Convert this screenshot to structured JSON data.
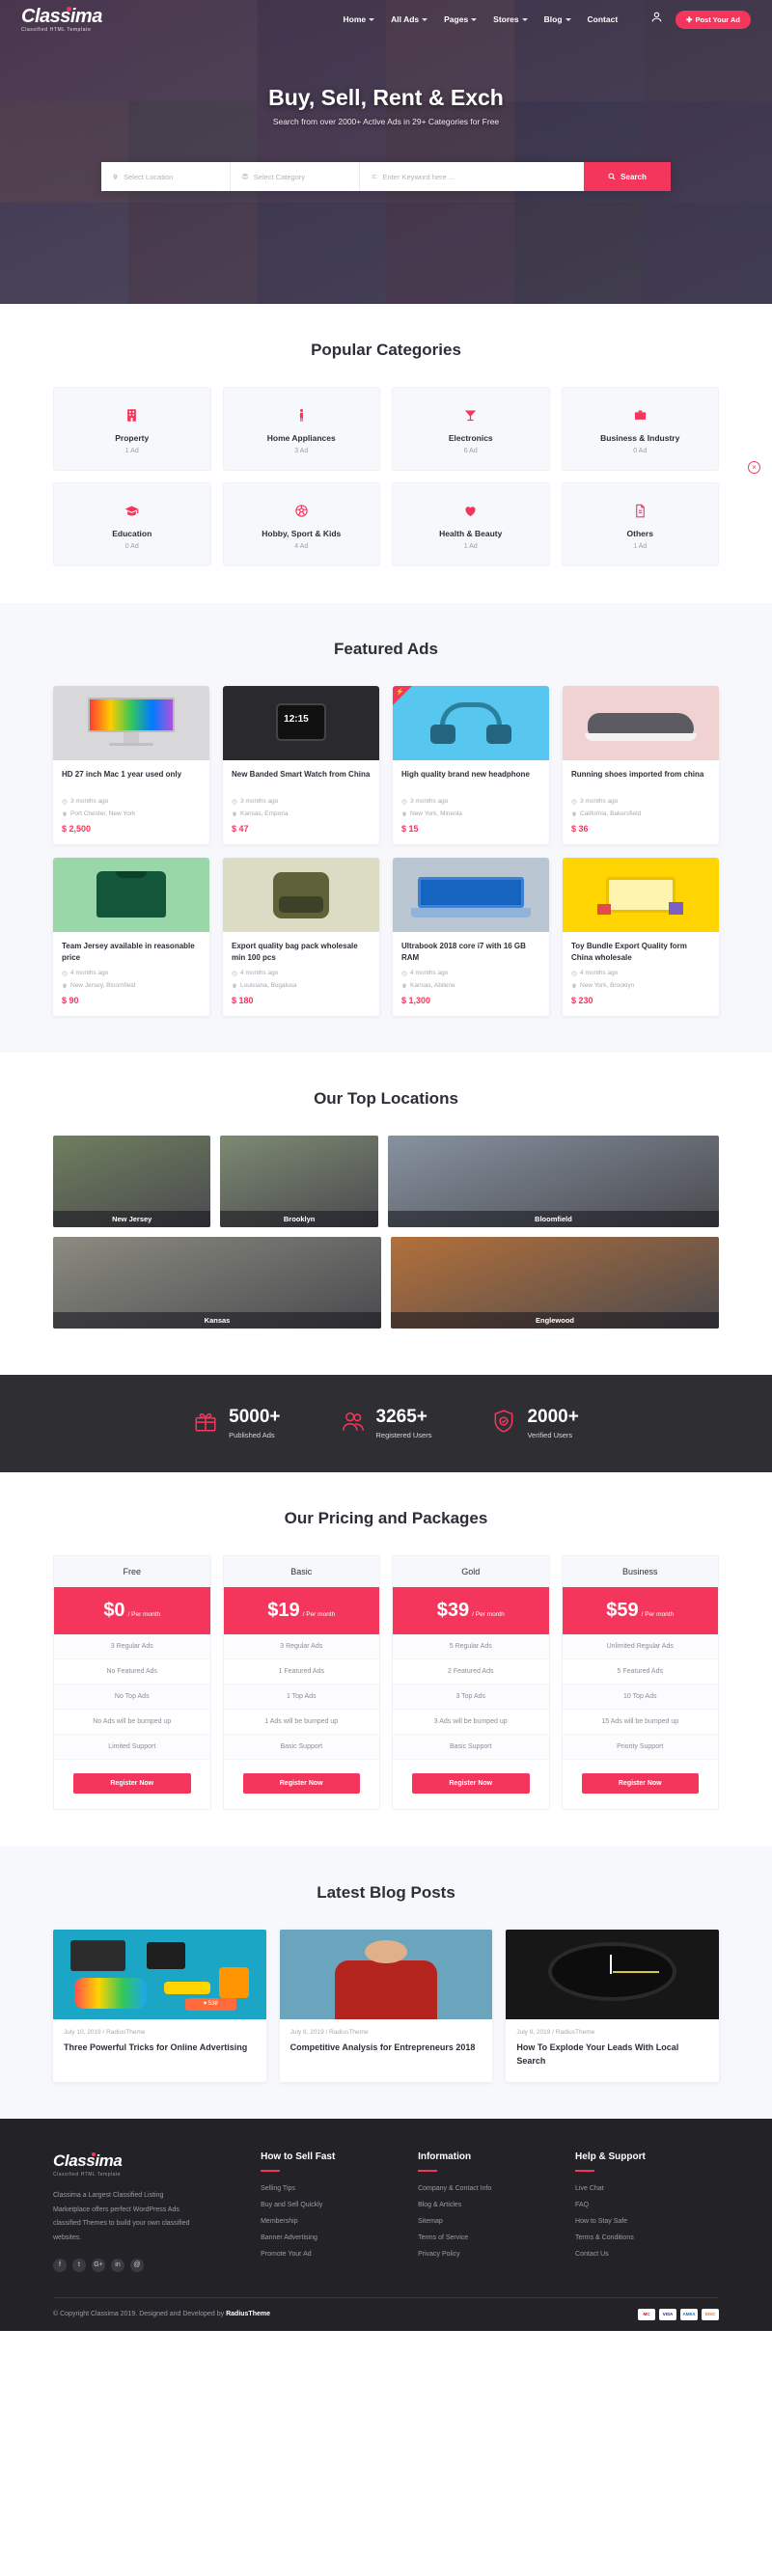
{
  "brand": {
    "name": "Classima",
    "tagline": "Classified HTML Template",
    "accent": "#f5365c"
  },
  "nav": {
    "items": [
      {
        "label": "Home",
        "caret": true
      },
      {
        "label": "All Ads",
        "caret": true
      },
      {
        "label": "Pages",
        "caret": true
      },
      {
        "label": "Stores",
        "caret": true
      },
      {
        "label": "Blog",
        "caret": true
      },
      {
        "label": "Contact",
        "caret": false
      }
    ],
    "post_ad_label": "Post Your Ad"
  },
  "hero": {
    "title": "Buy, Sell, Rent & Exch",
    "subtitle": "Search from over 2000+ Active Ads in 29+ Categories for Free",
    "search": {
      "location_placeholder": "Select Location",
      "category_placeholder": "Select Category",
      "keyword_placeholder": "Enter Keyword here ...",
      "button_label": "Search"
    }
  },
  "categories": {
    "title": "Popular Categories",
    "items": [
      {
        "name": "Property",
        "count": "1 Ad",
        "icon": "building-icon"
      },
      {
        "name": "Home Appliances",
        "count": "3 Ad",
        "icon": "person-icon"
      },
      {
        "name": "Electronics",
        "count": "6 Ad",
        "icon": "cocktail-icon"
      },
      {
        "name": "Business & Industry",
        "count": "0 Ad",
        "icon": "briefcase-icon"
      },
      {
        "name": "Education",
        "count": "0 Ad",
        "icon": "graduation-cap-icon"
      },
      {
        "name": "Hobby, Sport & Kids",
        "count": "4 Ad",
        "icon": "soccer-ball-icon"
      },
      {
        "name": "Health & Beauty",
        "count": "1 Ad",
        "icon": "heart-icon"
      },
      {
        "name": "Others",
        "count": "1 Ad",
        "icon": "document-icon"
      }
    ]
  },
  "featured": {
    "title": "Featured Ads",
    "items": [
      {
        "title": "HD 27 inch Mac 1 year used only",
        "time": "3 months ago",
        "location": "Port Chester, New York",
        "price": "$ 2,500",
        "featured": false,
        "bg": "#d8d8da"
      },
      {
        "title": "New Banded Smart Watch from China",
        "time": "3 months ago",
        "location": "Kansas, Emporia",
        "price": "$ 47",
        "featured": false,
        "bg": "#2a2a2e"
      },
      {
        "title": "High quality brand new headphone",
        "time": "3 months ago",
        "location": "New York, Mineola",
        "price": "$ 15",
        "featured": true,
        "bg": "#58c7f0"
      },
      {
        "title": "Running shoes imported from china",
        "time": "3 months ago",
        "location": "California, Bakersfield",
        "price": "$ 36",
        "featured": false,
        "bg": "#f0d2d2"
      },
      {
        "title": "Team Jersey available in reasonable price",
        "time": "4 months ago",
        "location": "New Jersey, Bloomfield",
        "price": "$ 90",
        "featured": false,
        "bg": "#9ad7a8"
      },
      {
        "title": "Export quality bag pack wholesale min 100 pcs",
        "time": "4 months ago",
        "location": "Louisiana, Bogalusa",
        "price": "$ 180",
        "featured": false,
        "bg": "#dcdcc4"
      },
      {
        "title": "Ultrabook 2018 core i7 with 16 GB RAM",
        "time": "4 months ago",
        "location": "Kansas, Abilene",
        "price": "$ 1,300",
        "featured": false,
        "bg": "#b9c6d2"
      },
      {
        "title": "Toy Bundle Export Quality form China wholesale",
        "time": "4 months ago",
        "location": "New York, Brooklyn",
        "price": "$ 230",
        "featured": false,
        "bg": "#ffd400"
      }
    ]
  },
  "locations": {
    "title": "Our Top Locations",
    "items": [
      {
        "name": "New Jersey",
        "bg": "#6f7f5e"
      },
      {
        "name": "Brooklyn",
        "bg": "#7d8a72"
      },
      {
        "name": "Bloomfield",
        "bg": "#8792a0"
      },
      {
        "name": "Kansas",
        "bg": "#8b8b80"
      },
      {
        "name": "Englewood",
        "bg": "#b4703a"
      }
    ]
  },
  "counters": [
    {
      "number": "5000+",
      "label": "Published Ads",
      "icon": "gift-icon"
    },
    {
      "number": "3265+",
      "label": "Registered Users",
      "icon": "users-icon"
    },
    {
      "number": "2000+",
      "label": "Verified Users",
      "icon": "shield-check-icon"
    }
  ],
  "pricing": {
    "title": "Our Pricing and Packages",
    "per_month": "/ Per month",
    "register_label": "Register Now",
    "plans": [
      {
        "name": "Free",
        "price": "$0",
        "features": [
          "3 Regular Ads",
          "No Featured Ads",
          "No Top Ads",
          "No Ads will be bumped up",
          "Limited Support"
        ]
      },
      {
        "name": "Basic",
        "price": "$19",
        "features": [
          "3 Regular Ads",
          "1 Featured Ads",
          "1 Top Ads",
          "1 Ads will be bumped up",
          "Basic Support"
        ]
      },
      {
        "name": "Gold",
        "price": "$39",
        "features": [
          "5 Regular Ads",
          "2 Featured Ads",
          "3 Top Ads",
          "3 Ads will be bumped up",
          "Basic Support"
        ]
      },
      {
        "name": "Business",
        "price": "$59",
        "features": [
          "Unlimited Regular Ads",
          "5 Featured Ads",
          "10 Top Ads",
          "15 Ads will be bumped up",
          "Priority Support"
        ]
      }
    ]
  },
  "blog": {
    "title": "Latest Blog Posts",
    "posts": [
      {
        "meta": "July 10, 2019 / RadiusTheme",
        "title": "Three Powerful Tricks for Online Advertising",
        "bg": "#1aa6c4"
      },
      {
        "meta": "July 8, 2019 / RadiusTheme",
        "title": "Competitive Analysis for Entrepreneurs 2018",
        "bg": "#6aa5bd"
      },
      {
        "meta": "July 8, 2019 / RadiusTheme",
        "title": "How To Explode Your Leads With Local Search",
        "bg": "#171717"
      }
    ]
  },
  "footer": {
    "description": "Classima a Largest Classified Listing Marketplace offers perfect WordPress Ads classified Themes to build your own classified websites.",
    "socials": [
      "f",
      "t",
      "G+",
      "in",
      "@"
    ],
    "columns": [
      {
        "heading": "How to Sell Fast",
        "links": [
          "Selling Tips",
          "Buy and Sell Quickly",
          "Membership",
          "Banner Advertising",
          "Promote Your Ad"
        ]
      },
      {
        "heading": "Information",
        "links": [
          "Company & Contact Info",
          "Blog & Articles",
          "Sitemap",
          "Terms of Service",
          "Privacy Policy"
        ]
      },
      {
        "heading": "Help & Support",
        "links": [
          "Live Chat",
          "FAQ",
          "How to Stay Safe",
          "Terms & Conditions",
          "Contact Us"
        ]
      }
    ],
    "copyright_prefix": "© Copyright Classima 2019. Designed and Developed by ",
    "copyright_brand": "RadiusTheme",
    "payment_cards": [
      "MC",
      "VISA",
      "AMEX",
      "DISC"
    ]
  },
  "side_widget": {
    "label": "×"
  }
}
